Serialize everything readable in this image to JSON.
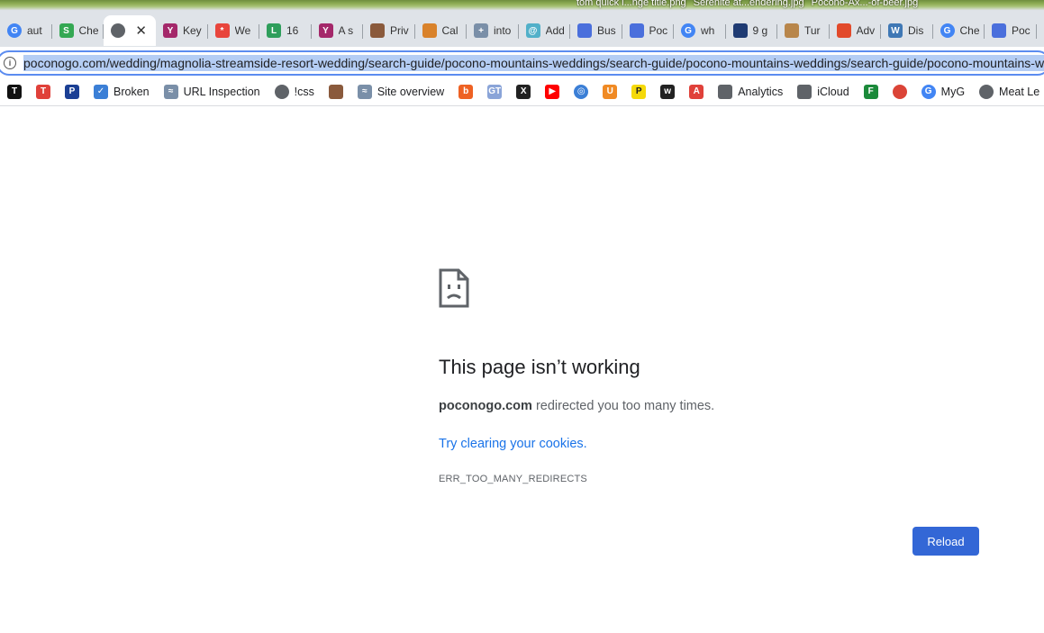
{
  "desktop_files": [
    "tom quick i...nge title.png",
    "Serenite at...endering.jpg",
    "Pocono-Ax...-of-beer.jpg"
  ],
  "tabs": [
    {
      "title": "aut",
      "icon": "google-icon",
      "color": "#4285f4",
      "glyph": "G"
    },
    {
      "title": "Che",
      "icon": "s-circle-icon",
      "color": "#34a853",
      "glyph": "S"
    },
    {
      "title": "",
      "icon": "globe-icon",
      "color": "#5f6368",
      "glyph": "",
      "active": true
    },
    {
      "title": "Key",
      "icon": "yoast-icon",
      "color": "#a4286a",
      "glyph": "Y"
    },
    {
      "title": "We",
      "icon": "asterisk-icon",
      "color": "#e8453c",
      "glyph": "*"
    },
    {
      "title": "16",
      "icon": "chart-icon",
      "color": "#2e9e5b",
      "glyph": "L"
    },
    {
      "title": "A s",
      "icon": "yoast-icon",
      "color": "#a4286a",
      "glyph": "Y"
    },
    {
      "title": "Priv",
      "icon": "photo-icon",
      "color": "#8a5a3c",
      "glyph": ""
    },
    {
      "title": "Cal",
      "icon": "chicken-icon",
      "color": "#d9822b",
      "glyph": ""
    },
    {
      "title": "into",
      "icon": "puzzle-icon",
      "color": "#7a8fa8",
      "glyph": "+"
    },
    {
      "title": "Add",
      "icon": "swirl-icon",
      "color": "#52b0c9",
      "glyph": "@"
    },
    {
      "title": "Bus",
      "icon": "business-icon",
      "color": "#4a6fdc",
      "glyph": ""
    },
    {
      "title": "Poc",
      "icon": "business-icon",
      "color": "#4a6fdc",
      "glyph": ""
    },
    {
      "title": "wh",
      "icon": "google-icon",
      "color": "#4285f4",
      "glyph": "G"
    },
    {
      "title": "9 g",
      "icon": "chat-icon",
      "color": "#1f3b73",
      "glyph": ""
    },
    {
      "title": "Tur",
      "icon": "trophy-icon",
      "color": "#b8864b",
      "glyph": ""
    },
    {
      "title": "Adv",
      "icon": "lego-icon",
      "color": "#e24a2b",
      "glyph": ""
    },
    {
      "title": "Dis",
      "icon": "wordpress-icon",
      "color": "#3f78b5",
      "glyph": "W"
    },
    {
      "title": "Che",
      "icon": "google-icon",
      "color": "#4285f4",
      "glyph": "G"
    },
    {
      "title": "Poc",
      "icon": "business-icon",
      "color": "#4a6fdc",
      "glyph": ""
    },
    {
      "title": "",
      "icon": "business-icon",
      "color": "#4a6fdc",
      "glyph": ""
    }
  ],
  "omnibox": {
    "url": "poconogo.com/wedding/magnolia-streamside-resort-wedding/search-guide/pocono-mountains-weddings/search-guide/pocono-mountains-weddings/search-guide/pocono-mountains-weddings"
  },
  "bookmarks": [
    {
      "label": "",
      "icon": "nyt-icon",
      "color": "#111111",
      "glyph": "T"
    },
    {
      "label": "",
      "icon": "nyt-red-icon",
      "color": "#e0413a",
      "glyph": "T"
    },
    {
      "label": "",
      "icon": "paypal-icon",
      "color": "#1b3f94",
      "glyph": "P"
    },
    {
      "label": "Broken",
      "icon": "checkmark-icon",
      "color": "#3b7fd6",
      "glyph": "✓"
    },
    {
      "label": "URL Inspection",
      "icon": "search-console-icon",
      "color": "#7a8fa8",
      "glyph": "≈"
    },
    {
      "label": "!css",
      "icon": "globe-icon",
      "color": "#5f6368",
      "glyph": ""
    },
    {
      "label": "",
      "icon": "photo-icon",
      "color": "#8a5a3c",
      "glyph": ""
    },
    {
      "label": "Site overview",
      "icon": "search-console-icon",
      "color": "#7a8fa8",
      "glyph": "≈"
    },
    {
      "label": "",
      "icon": "bitly-icon",
      "color": "#ee6123",
      "glyph": "b"
    },
    {
      "label": "",
      "icon": "gtmetrix-icon",
      "color": "#8aa4d8",
      "glyph": "GT"
    },
    {
      "label": "",
      "icon": "x-icon",
      "color": "#222222",
      "glyph": "X"
    },
    {
      "label": "",
      "icon": "youtube-icon",
      "color": "#ff0000",
      "glyph": "▶"
    },
    {
      "label": "",
      "icon": "target-icon",
      "color": "#3b7fd6",
      "glyph": "◎"
    },
    {
      "label": "",
      "icon": "u-icon",
      "color": "#f08a24",
      "glyph": "U"
    },
    {
      "label": "",
      "icon": "p-icon",
      "color": "#f5d90a",
      "glyph": "P"
    },
    {
      "label": "",
      "icon": "w-icon",
      "color": "#222222",
      "glyph": "w"
    },
    {
      "label": "",
      "icon": "acrobat-icon",
      "color": "#e0413a",
      "glyph": "A"
    },
    {
      "label": "Analytics",
      "icon": "folder-icon",
      "color": "#5f6368",
      "glyph": ""
    },
    {
      "label": "iCloud",
      "icon": "apple-icon",
      "color": "#5f6368",
      "glyph": ""
    },
    {
      "label": "",
      "icon": "f-icon",
      "color": "#1b8a3a",
      "glyph": "F"
    },
    {
      "label": "",
      "icon": "chrome-icon",
      "color": "#db4437",
      "glyph": ""
    },
    {
      "label": "MyG",
      "icon": "google-icon",
      "color": "#4285f4",
      "glyph": "G"
    },
    {
      "label": "Meat Le",
      "icon": "globe-icon",
      "color": "#5f6368",
      "glyph": ""
    }
  ],
  "error": {
    "title": "This page isn’t working",
    "domain": "poconogo.com",
    "summary_rest": " redirected you too many times.",
    "suggestion": "Try clearing your cookies.",
    "code": "ERR_TOO_MANY_REDIRECTS",
    "reload_label": "Reload"
  },
  "colors": {
    "accent": "#3367d6",
    "link": "#1a73e8",
    "url_highlight": "#b4cdf4"
  }
}
